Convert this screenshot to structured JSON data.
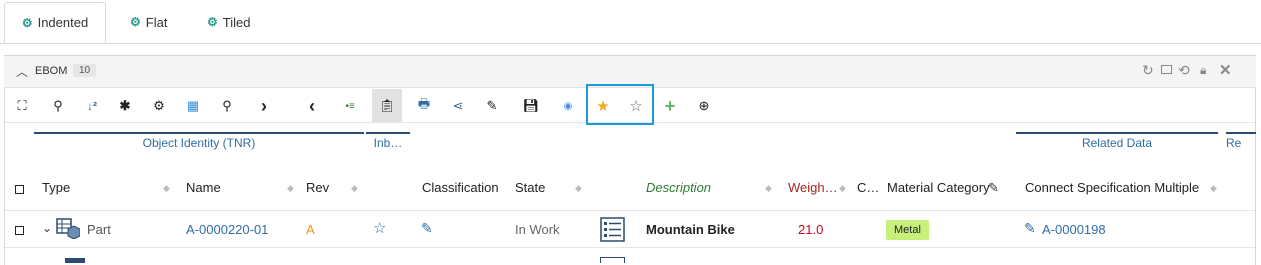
{
  "tabs": [
    {
      "label": "Indented",
      "icon": "gears-icon",
      "active": true
    },
    {
      "label": "Flat",
      "icon": "gears-icon",
      "active": false
    },
    {
      "label": "Tiled",
      "icon": "gears-icon",
      "active": false
    }
  ],
  "panel": {
    "title": "EBOM",
    "count": "10"
  },
  "groups": {
    "object_identity": "Object Identity (TNR)",
    "inbox": "Inb…",
    "related_data": "Related Data",
    "re": "Re"
  },
  "columns": {
    "type": "Type",
    "name": "Name",
    "rev": "Rev",
    "classification": "Classification",
    "state": "State",
    "description": "Description",
    "weight": "Weigh…",
    "c": "C…",
    "material_category": "Material Category",
    "connect_spec": "Connect Specification Multiple"
  },
  "row": {
    "type": "Part",
    "name": "A-0000220-01",
    "rev": "A",
    "state": "In Work",
    "description": "Mountain Bike",
    "weight": "21.0",
    "material": "Metal",
    "spec": "A-0000198"
  },
  "colors": {
    "accent": "#1a9bd7",
    "link": "#2f6ea5",
    "rev": "#f08c1a",
    "weight": "#d0021b",
    "description_header": "#2e7d32",
    "weight_header": "#a0281e",
    "metal_badge": "#c6f07a"
  }
}
